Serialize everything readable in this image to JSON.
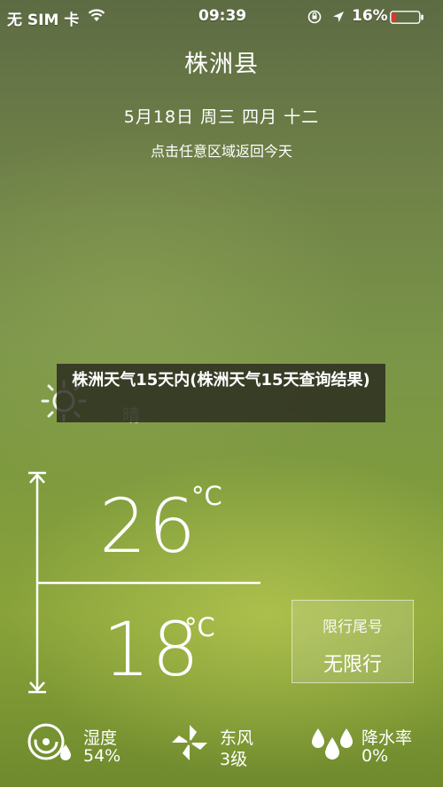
{
  "status_bar": {
    "carrier": "无 SIM 卡",
    "time": "09:39",
    "battery": "16%",
    "battery_level": 0.16,
    "battery_color": "#e8312a"
  },
  "header": {
    "city": "株洲县",
    "date": "5月18日  周三   四月 十二",
    "hint": "点击任意区域返回今天"
  },
  "banner": {
    "text": "株洲天气15天内(株洲天气15天查询结果)"
  },
  "weather": {
    "icon": "sun-icon",
    "condition": "晴",
    "high": "26",
    "low": "18",
    "unit": "°C"
  },
  "traffic_limit": {
    "title": "限行尾号",
    "value": "无限行"
  },
  "metrics": [
    {
      "icon": "humidity-icon",
      "label": "湿度",
      "value": "54%"
    },
    {
      "icon": "wind-icon",
      "label": "东风",
      "value": "3级"
    },
    {
      "icon": "rain-drops-icon",
      "label": "降水率",
      "value": "0%"
    }
  ]
}
